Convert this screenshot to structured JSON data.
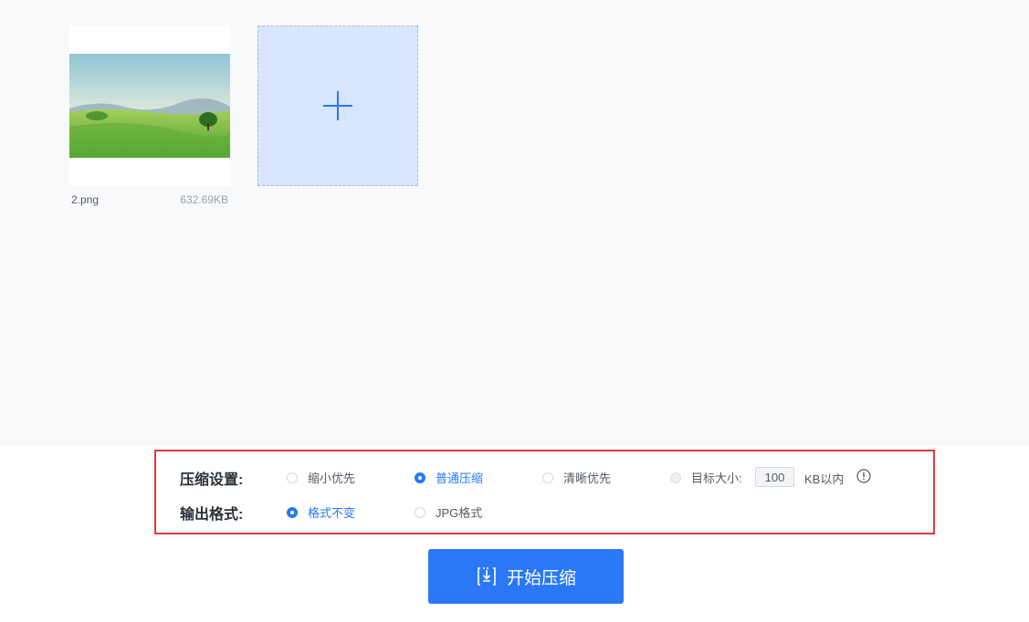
{
  "file": {
    "name": "2.png",
    "size": "632.69KB"
  },
  "compression": {
    "label": "压缩设置:",
    "options": [
      {
        "label": "缩小优先",
        "selected": false
      },
      {
        "label": "普通压缩",
        "selected": true
      },
      {
        "label": "清晰优先",
        "selected": false
      },
      {
        "label": "目标大小:",
        "selected": false
      }
    ],
    "target_value": "100",
    "target_unit": "KB以内"
  },
  "output": {
    "label": "输出格式:",
    "options": [
      {
        "label": "格式不变",
        "selected": true
      },
      {
        "label": "JPG格式",
        "selected": false
      }
    ]
  },
  "start_button": {
    "label": "开始压缩"
  },
  "icons": {
    "add": "plus-icon",
    "info": "info-icon",
    "start": "compress-icon"
  },
  "colors": {
    "accent": "#2a78f5",
    "highlight_border": "#e53a3a",
    "add_box_bg": "#d8e5fd"
  }
}
